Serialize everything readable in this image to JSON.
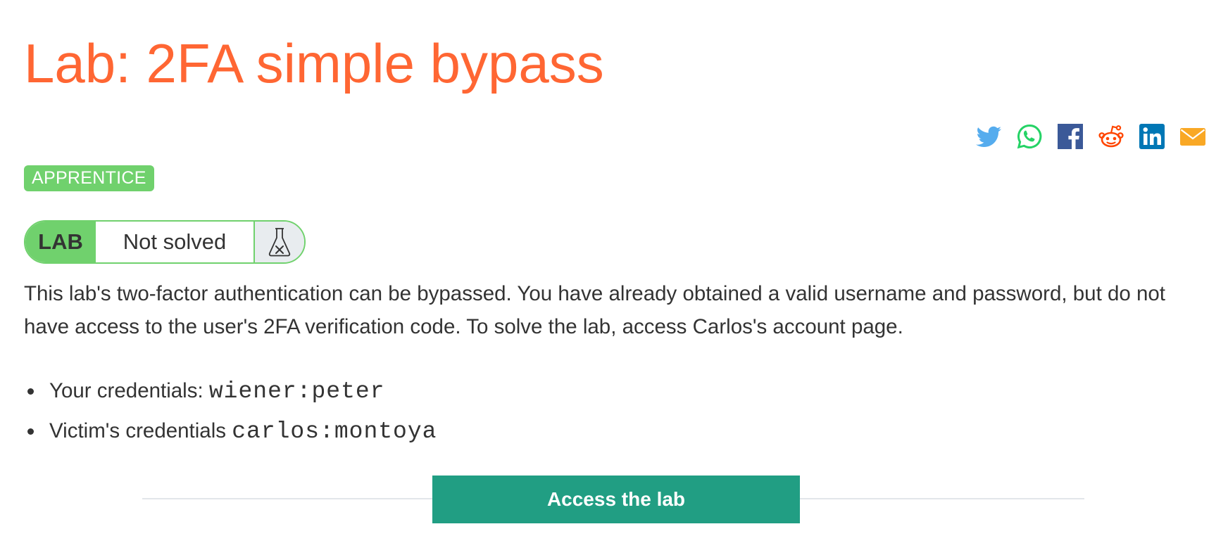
{
  "page": {
    "title": "Lab: 2FA simple bypass"
  },
  "share": {
    "icons": [
      "twitter-icon",
      "whatsapp-icon",
      "facebook-icon",
      "reddit-icon",
      "linkedin-icon",
      "email-icon"
    ]
  },
  "difficulty": {
    "label": "APPRENTICE",
    "color": "#70d16d"
  },
  "lab_status": {
    "tag": "LAB",
    "status": "Not solved",
    "icon": "flask-not-solved-icon"
  },
  "description": "This lab's two-factor authentication can be bypassed. You have already obtained a valid username and password, but do not have access to the user's 2FA verification code. To solve the lab, access Carlos's account page.",
  "credentials": [
    {
      "label": "Your credentials: ",
      "value": "wiener:peter"
    },
    {
      "label": "Victim's credentials ",
      "value": "carlos:montoya"
    }
  ],
  "access_button": {
    "label": "Access the lab",
    "color": "#219e83"
  },
  "colors": {
    "title": "#ff6633",
    "accent_green": "#70d16d",
    "button": "#219e83",
    "twitter": "#55acee",
    "whatsapp": "#25d366",
    "facebook": "#3b5998",
    "reddit": "#ff4500",
    "linkedin": "#0077b5",
    "email": "#f9a825"
  }
}
